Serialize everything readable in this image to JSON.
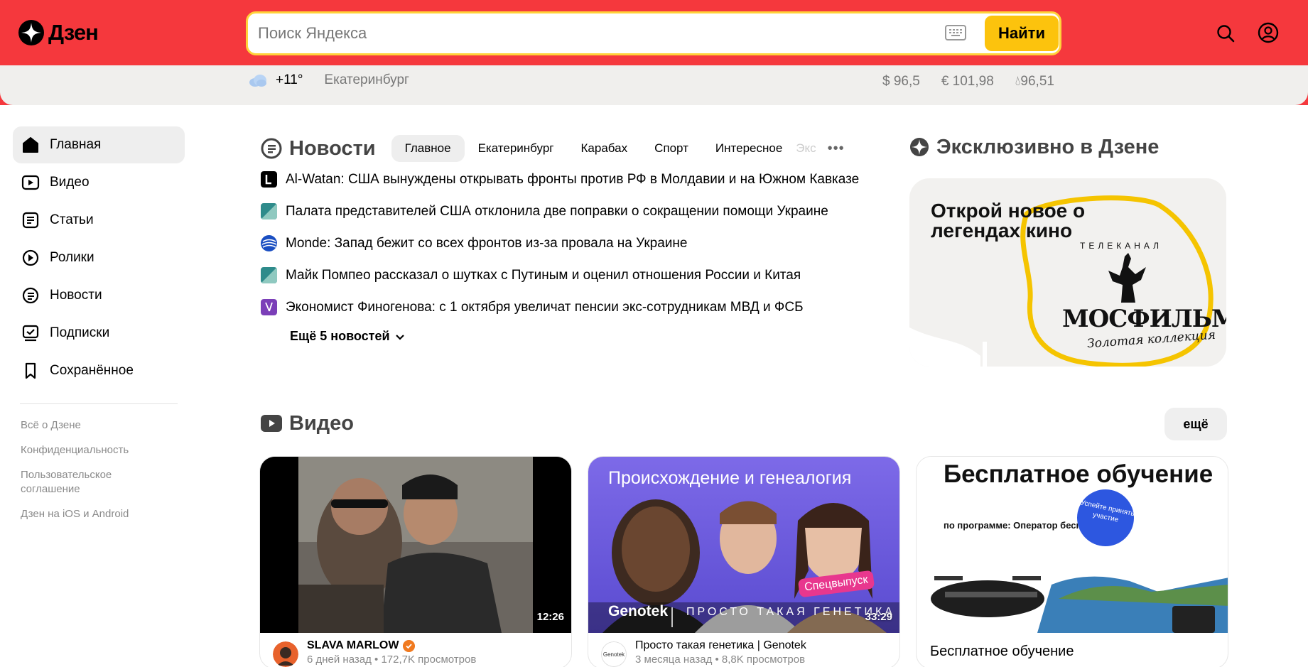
{
  "header": {
    "logo_text": "Дзен",
    "search_placeholder": "Поиск Яндекса",
    "search_value": "",
    "find_label": "Найти"
  },
  "infobar": {
    "temperature": "+11°",
    "city": "Екатеринбург",
    "usd": "$ 96,5",
    "eur": "€ 101,98",
    "oil": "96,51"
  },
  "sidebar": {
    "items": [
      {
        "label": "Главная",
        "icon": "home-icon"
      },
      {
        "label": "Видео",
        "icon": "video-icon"
      },
      {
        "label": "Статьи",
        "icon": "article-icon"
      },
      {
        "label": "Ролики",
        "icon": "clips-icon"
      },
      {
        "label": "Новости",
        "icon": "news-icon"
      },
      {
        "label": "Подписки",
        "icon": "subscriptions-icon"
      },
      {
        "label": "Сохранённое",
        "icon": "bookmark-icon"
      }
    ],
    "footer_links": [
      "Всё о Дзене",
      "Конфиденциальность",
      "Пользовательское соглашение",
      "Дзен на iOS и Android"
    ]
  },
  "news": {
    "title": "Новости",
    "tabs": [
      "Главное",
      "Екатеринбург",
      "Карабах",
      "Спорт",
      "Интересное",
      "Экс"
    ],
    "items": [
      "Al-Watan: США вынуждены открывать фронты против РФ в Молдавии и на Южном Кавказе",
      "Палата представителей США отклонила две поправки о сокращении помощи Украине",
      "Monde: Запад бежит со всех фронтов из-за провала на Украине",
      "Майк Помпео рассказал о шутках с Путиным и оценил отношения России и Китая",
      "Экономист Финогенова: с 1 октября увеличат пенсии экс-сотрудникам МВД и ФСБ"
    ],
    "more_label": "Ещё 5 новостей"
  },
  "exclusive": {
    "title": "Эксклюзивно в Дзене",
    "promo_text": "Открой новое о легендах кино",
    "promo_tv": "ТЕЛЕКАНАЛ",
    "promo_brand": "МОСФИЛЬМ",
    "promo_sub": "Золотая коллекция"
  },
  "video": {
    "title": "Видео",
    "more_label": "ещё",
    "cards": [
      {
        "duration": "12:26",
        "channel": "SLAVA MARLOW",
        "meta": "6 дней назад • 172,7K просмотров"
      },
      {
        "duration": "33:29",
        "channel": "Просто такая генетика | Genotek",
        "meta": "3 месяца назад • 8,8K просмотров",
        "thumb_title": "Происхождение и генеалогия",
        "thumb_brand": "Genotek",
        "thumb_brand2": "ПРОСТО ТАКАЯ ГЕНЕТИКА",
        "badge": "Спецвыпуск"
      },
      {
        "title": "Бесплатное обучение",
        "thumb_title": "Бесплатное обучение",
        "thumb_sub": "по программе: Оператор беспилотников",
        "thumb_badge": "Успейте принять участие"
      }
    ]
  }
}
